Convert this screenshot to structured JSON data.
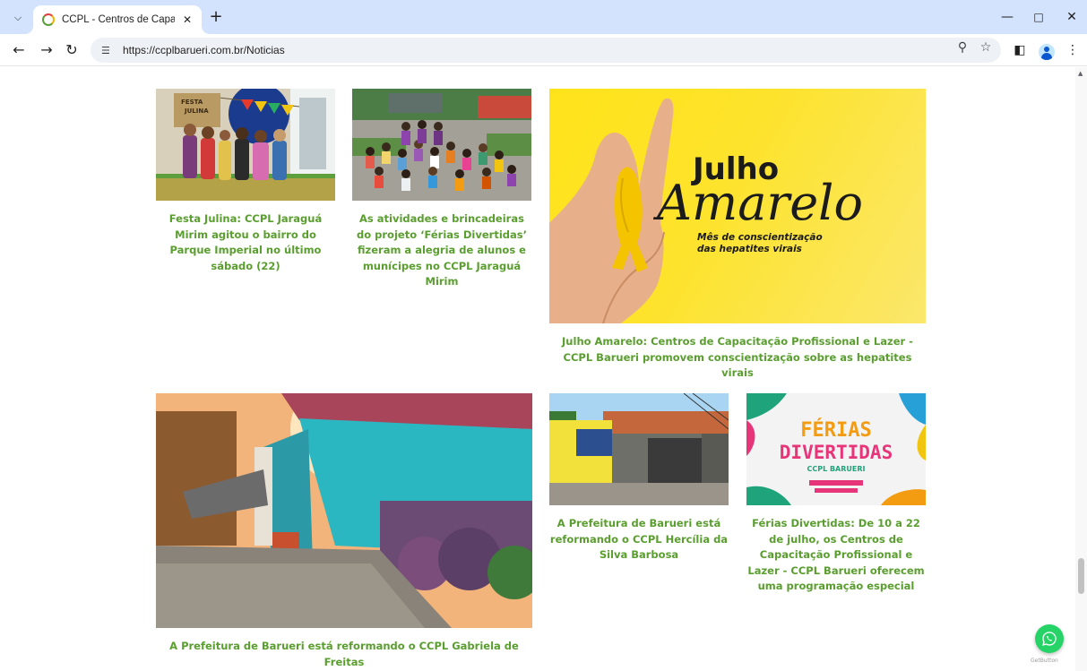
{
  "browser": {
    "tab_title": "CCPL - Centros de Capacitação",
    "url": "https://ccplbarueri.com.br/Noticias"
  },
  "icons": {
    "tab_search": "chevron-down-icon",
    "favicon": "ccpl-favicon",
    "tab_close": "close-icon",
    "new_tab": "plus-icon",
    "back": "back-arrow-icon",
    "forward": "forward-arrow-icon",
    "reload": "reload-icon",
    "site_info": "site-info-icon",
    "zoom": "zoom-icon",
    "bookmark": "star-icon",
    "side_panel": "side-panel-icon",
    "profile": "profile-icon",
    "menu": "kebab-menu-icon",
    "whatsapp": "whatsapp-icon"
  },
  "news": [
    {
      "caption": "Festa Julina: CCPL Jaraguá Mirim agitou o bairro do Parque Imperial no último sábado (22)",
      "image_text": "FESTA JULINA"
    },
    {
      "caption": "As atividades e brincadeiras do projeto ‘Férias Divertidas’ fizeram a alegria de alunos e munícipes no CCPL Jaraguá Mirim"
    },
    {
      "caption": "Julho Amarelo: Centros de Capacitação Profissional e Lazer - CCPL Barueri promovem conscientização sobre as hepatites virais",
      "image_title": "Julho",
      "image_script": "Amarelo",
      "image_subtitle_1": "Mês de conscientização",
      "image_subtitle_2": "das hepatites virais"
    },
    {
      "caption": "A Prefeitura de Barueri está reformando o CCPL Gabriela de Freitas"
    },
    {
      "caption": "A Prefeitura de Barueri está reformando o CCPL Hercília da Silva Barbosa"
    },
    {
      "caption": "Férias Divertidas: De 10 a 22 de julho, os Centros de Capacitação Profissional e Lazer - CCPL Barueri oferecem uma programação especial",
      "image_line_1": "FÉRIAS",
      "image_line_2": "DIVERTIDAS",
      "image_line_3": "CCPL BARUERI"
    }
  ],
  "whatsapp_label": "GetButton",
  "colors": {
    "caption_green": "#5a9e2f",
    "tab_bar": "#d3e3fd",
    "julho_yellow": "#ffe31a",
    "whatsapp_green": "#25d366"
  }
}
